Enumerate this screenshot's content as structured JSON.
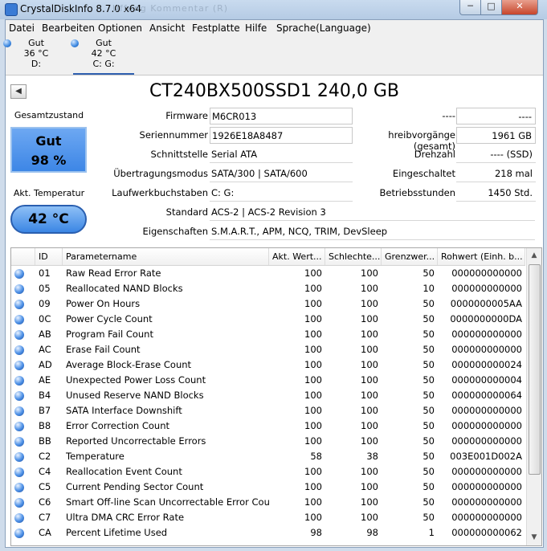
{
  "window": {
    "title": "CrystalDiskInfo 8.7.0 x64",
    "ghost_text": "Uffung  Kommentar  (R)",
    "minimize_glyph": "─",
    "maximize_glyph": "□",
    "close_glyph": "✕"
  },
  "menu": {
    "items": [
      "Datei",
      "Bearbeiten",
      "Optionen",
      "Ansicht",
      "Festplatte",
      "Hilfe",
      "Sprache(Language)"
    ]
  },
  "drives": [
    {
      "status": "Gut",
      "temp": "36 °C",
      "letter": "D:"
    },
    {
      "status": "Gut",
      "temp": "42 °C",
      "letter": "C: G:"
    }
  ],
  "nav": {
    "prev_glyph": "◀"
  },
  "model": {
    "title": "CT240BX500SSD1 240,0 GB"
  },
  "health": {
    "label": "Gesamtzustand",
    "status": "Gut",
    "percent": "98 %",
    "temp_label": "Akt. Temperatur",
    "temp": "42 °C"
  },
  "info": {
    "firmware_label": "Firmware",
    "firmware": "M6CR013",
    "serial_label": "Seriennummer",
    "serial": "1926E18A8487",
    "interface_label": "Schnittstelle",
    "interface": "Serial ATA",
    "transfer_label": "Übertragungsmodus",
    "transfer": "SATA/300 | SATA/600",
    "letters_label": "Laufwerkbuchstaben",
    "letters": "C: G:",
    "standard_label": "Standard",
    "standard": "ACS-2 | ACS-2 Revision 3",
    "features_label": "Eigenschaften",
    "features": "S.M.A.R.T., APM, NCQ, TRIM, DevSleep",
    "r1_label": "----",
    "r1_value": "----",
    "writes_label": "hreibvorgänge (gesamt)",
    "writes": "1961 GB",
    "rpm_label": "Drehzahl",
    "rpm": "---- (SSD)",
    "poweron_label": "Eingeschaltet",
    "poweron": "218 mal",
    "hours_label": "Betriebsstunden",
    "hours": "1450 Std."
  },
  "table": {
    "headers": [
      "ID",
      "Parametername",
      "Akt. Wert...",
      "Schlechte...",
      "Grenzwer...",
      "Rohwert (Einh. b..."
    ],
    "rows": [
      {
        "id": "01",
        "name": "Raw Read Error Rate",
        "current": "100",
        "worst": "100",
        "threshold": "50",
        "raw": "000000000000"
      },
      {
        "id": "05",
        "name": "Reallocated NAND Blocks",
        "current": "100",
        "worst": "100",
        "threshold": "10",
        "raw": "000000000000"
      },
      {
        "id": "09",
        "name": "Power On Hours",
        "current": "100",
        "worst": "100",
        "threshold": "50",
        "raw": "0000000005AA"
      },
      {
        "id": "0C",
        "name": "Power Cycle Count",
        "current": "100",
        "worst": "100",
        "threshold": "50",
        "raw": "0000000000DA"
      },
      {
        "id": "AB",
        "name": "Program Fail Count",
        "current": "100",
        "worst": "100",
        "threshold": "50",
        "raw": "000000000000"
      },
      {
        "id": "AC",
        "name": "Erase Fail Count",
        "current": "100",
        "worst": "100",
        "threshold": "50",
        "raw": "000000000000"
      },
      {
        "id": "AD",
        "name": "Average Block-Erase Count",
        "current": "100",
        "worst": "100",
        "threshold": "50",
        "raw": "000000000024"
      },
      {
        "id": "AE",
        "name": "Unexpected Power Loss Count",
        "current": "100",
        "worst": "100",
        "threshold": "50",
        "raw": "000000000004"
      },
      {
        "id": "B4",
        "name": "Unused Reserve NAND Blocks",
        "current": "100",
        "worst": "100",
        "threshold": "50",
        "raw": "000000000064"
      },
      {
        "id": "B7",
        "name": "SATA Interface Downshift",
        "current": "100",
        "worst": "100",
        "threshold": "50",
        "raw": "000000000000"
      },
      {
        "id": "B8",
        "name": "Error Correction Count",
        "current": "100",
        "worst": "100",
        "threshold": "50",
        "raw": "000000000000"
      },
      {
        "id": "BB",
        "name": "Reported Uncorrectable Errors",
        "current": "100",
        "worst": "100",
        "threshold": "50",
        "raw": "000000000000"
      },
      {
        "id": "C2",
        "name": "Temperature",
        "current": "58",
        "worst": "38",
        "threshold": "50",
        "raw": "003E001D002A"
      },
      {
        "id": "C4",
        "name": "Reallocation Event Count",
        "current": "100",
        "worst": "100",
        "threshold": "50",
        "raw": "000000000000"
      },
      {
        "id": "C5",
        "name": "Current Pending Sector Count",
        "current": "100",
        "worst": "100",
        "threshold": "50",
        "raw": "000000000000"
      },
      {
        "id": "C6",
        "name": "Smart Off-line Scan Uncorrectable Error Count",
        "current": "100",
        "worst": "100",
        "threshold": "50",
        "raw": "000000000000"
      },
      {
        "id": "C7",
        "name": "Ultra DMA CRC Error Rate",
        "current": "100",
        "worst": "100",
        "threshold": "50",
        "raw": "000000000000"
      },
      {
        "id": "CA",
        "name": "Percent Lifetime Used",
        "current": "98",
        "worst": "98",
        "threshold": "1",
        "raw": "000000000062"
      }
    ]
  },
  "scrollbar": {
    "up_glyph": "▲",
    "down_glyph": "▼"
  }
}
